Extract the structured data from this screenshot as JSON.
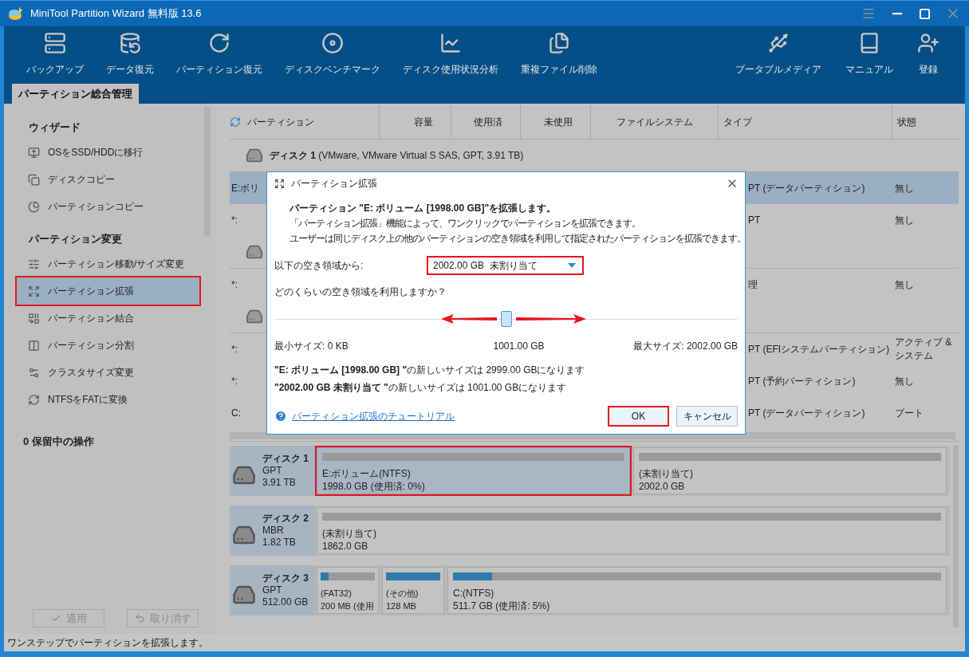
{
  "window": {
    "title": "MiniTool Partition Wizard 無料版 13.6"
  },
  "toolbar": {
    "left": [
      {
        "label": "バックアップ",
        "kind": "backup"
      },
      {
        "label": "データ復元",
        "kind": "data-recovery"
      },
      {
        "label": "パーティション復元",
        "kind": "partition-recovery"
      },
      {
        "label": "ディスクベンチマーク",
        "kind": "benchmark"
      },
      {
        "label": "ディスク使用状況分析",
        "kind": "analyzer"
      },
      {
        "label": "重複ファイル削除",
        "kind": "duplicates"
      }
    ],
    "right": [
      {
        "label": "ブータブルメディア",
        "kind": "media"
      },
      {
        "label": "マニュアル",
        "kind": "manual"
      },
      {
        "label": "登録",
        "kind": "register"
      }
    ]
  },
  "tabs": [
    {
      "label": "パーティション総合管理",
      "selected": true
    }
  ],
  "sidebar": {
    "sections": [
      {
        "title": "ウィザード",
        "items": [
          {
            "label": "OSをSSD/HDDに移行",
            "kind": "migrate",
            "selected": false,
            "marked": false
          },
          {
            "label": "ディスクコピー",
            "kind": "disk-copy",
            "selected": false,
            "marked": false
          },
          {
            "label": "パーティションコピー",
            "kind": "partition-copy",
            "selected": false,
            "marked": false
          }
        ]
      },
      {
        "title": "パーティション変更",
        "items": [
          {
            "label": "パーティション移動/サイズ変更",
            "kind": "resize",
            "selected": false,
            "marked": false
          },
          {
            "label": "パーティション拡張",
            "kind": "extend",
            "selected": true,
            "marked": true
          },
          {
            "label": "パーティション結合",
            "kind": "merge",
            "selected": false,
            "marked": false
          },
          {
            "label": "パーティション分割",
            "kind": "split",
            "selected": false,
            "marked": false
          },
          {
            "label": "クラスタサイズ変更",
            "kind": "cluster",
            "selected": false,
            "marked": false
          },
          {
            "label": "NTFSをFATに変換",
            "kind": "convert",
            "selected": false,
            "marked": false
          }
        ]
      }
    ],
    "pending": "0 保留中の操作",
    "buttons": [
      {
        "label": "適用",
        "kind": "apply",
        "disabled": true
      },
      {
        "label": "取り消す",
        "kind": "undo",
        "disabled": true
      }
    ]
  },
  "table": {
    "columns": [
      "パーティション",
      "容量",
      "使用済",
      "未使用",
      "ファイルシステム",
      "タイプ",
      "状態"
    ],
    "rows": [
      {
        "kind": "disk",
        "label": "ディスク 1",
        "details": "(VMware, VMware Virtual S SAS, GPT, 3.91 TB)"
      },
      {
        "kind": "partition",
        "partition": "E:ボリ",
        "type": "PT (データパーティション)",
        "status": "無し",
        "selected": true
      },
      {
        "kind": "partition",
        "partition": "*:",
        "type": "PT",
        "status": "無し",
        "selected": false
      },
      {
        "kind": "disk"
      },
      {
        "kind": "partition",
        "partition": "*:",
        "type": "理",
        "status": "無し",
        "selected": false
      },
      {
        "kind": "disk"
      },
      {
        "kind": "partition",
        "partition": "*:",
        "type": "PT (EFIシステムパーティション)",
        "status": "アクティブ & システム",
        "selected": false
      },
      {
        "kind": "partition",
        "partition": "*:",
        "type": "PT (予約パーティション)",
        "status": "無し",
        "selected": false
      },
      {
        "kind": "partition",
        "partition": "C:",
        "type": "PT (データパーティション)",
        "status": "ブート",
        "selected": false
      }
    ]
  },
  "disk_map": [
    {
      "name": "ディスク 1",
      "scheme": "GPT",
      "size": "3.91 TB",
      "partitions": [
        {
          "kind": "wide",
          "label": "E:ボリューム(NTFS)",
          "size": "1998.0 GB (使用済: 0%)",
          "level": 0,
          "selected": true,
          "marked": true
        },
        {
          "kind": "wide",
          "label": "(未割り当て)",
          "size": "2002.0 GB",
          "level": 0,
          "selected": false,
          "marked": false
        }
      ]
    },
    {
      "name": "ディスク 2",
      "scheme": "MBR",
      "size": "1.82 TB",
      "partitions": [
        {
          "kind": "wide",
          "label": "(未割り当て)",
          "size": "1862.0 GB",
          "level": 0,
          "selected": false,
          "marked": false
        }
      ]
    },
    {
      "name": "ディスク 3",
      "scheme": "GPT",
      "size": "512.00 GB",
      "partitions": [
        {
          "kind": "small",
          "label": "(FAT32)",
          "size": "200 MB (使用",
          "level": 0.15,
          "selected": false,
          "marked": false
        },
        {
          "kind": "small",
          "label": "(その他)",
          "size": "128 MB",
          "level": 1,
          "selected": false,
          "marked": false
        },
        {
          "kind": "wide",
          "label": "C:(NTFS)",
          "size": "511.7 GB (使用済: 5%)",
          "level": 0.08,
          "selected": false,
          "marked": false
        }
      ]
    }
  ],
  "dialog": {
    "title": "パーティション拡張",
    "heading": "パーティション \"E: ボリューム [1998.00 GB]\"を拡張します。",
    "descriptions": [
      "「パーティション拡張」機能によって、ワンクリックでパーティションを拡張できます。",
      "ユーザーは同じディスク上の他のパーティションの空き領域を利用して指定されたパーティションを拡張できます。"
    ],
    "source": {
      "label": "以下の空き領域から:",
      "value": "2002.00 GB  未割り当て",
      "marked": true
    },
    "question": "どのくらいの空き領域を利用しますか？",
    "slider": {
      "level": 0.5
    },
    "min": "最小サイズ: 0 KB",
    "mid": "1001.00 GB",
    "max": "最大サイズ: 2002.00 GB",
    "results": [
      "**\"E: ボリューム [1998.00 GB] \"**の新しいサイズは 2999.00 GBになります",
      "**\"2002.00 GB 未割り当て \"**の新しいサイズは 1001.00 GBになります"
    ],
    "help_link": "パーティション拡張のチュートリアル",
    "buttons": [
      {
        "label": "OK",
        "marked": true
      },
      {
        "label": "キャンセル",
        "marked": false
      }
    ]
  },
  "status_bar": "ワンステップでパーティションを拡張します。"
}
